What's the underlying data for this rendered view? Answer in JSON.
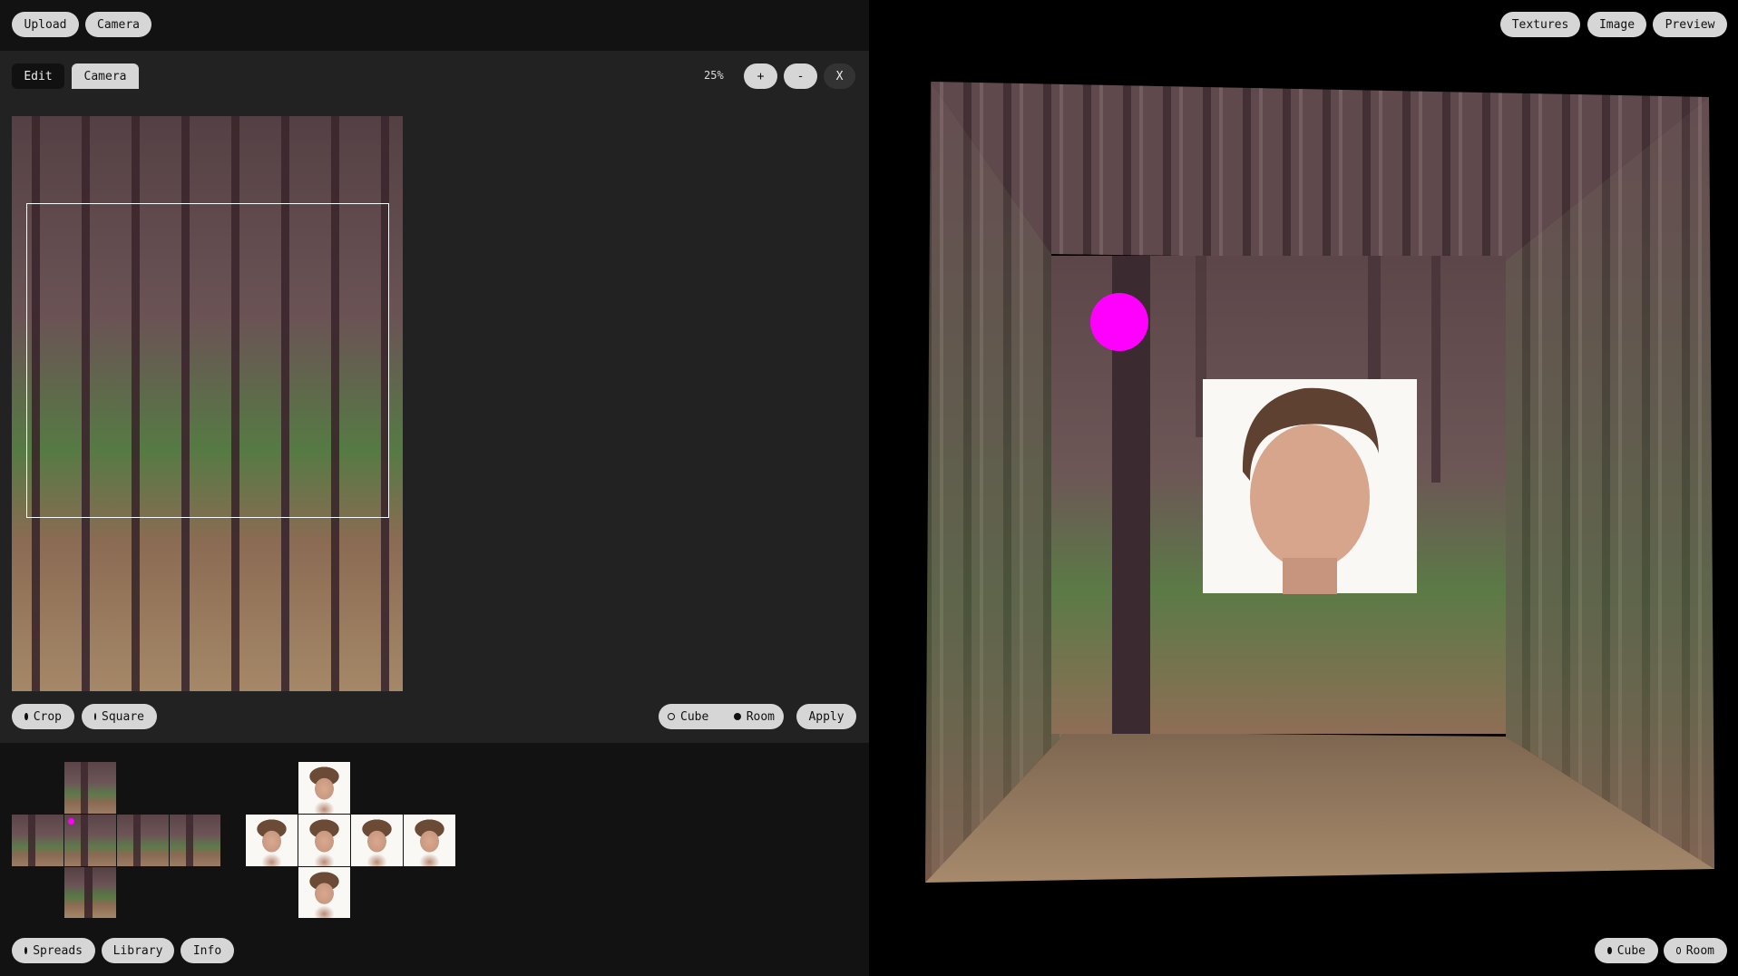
{
  "topbar": {
    "upload_label": "Upload",
    "camera_label": "Camera"
  },
  "editor": {
    "tabs": [
      {
        "label": "Edit",
        "active": true
      },
      {
        "label": "Camera",
        "active": false
      }
    ],
    "zoom": "25%",
    "zoom_in_label": "+",
    "zoom_out_label": "-",
    "close_label": "X",
    "crop_label": "Crop",
    "square_label": "Square",
    "cube_label": "Cube",
    "room_label": "Room",
    "apply_label": "Apply"
  },
  "bottom": {
    "spreads_label": "Spreads",
    "library_label": "Library",
    "info_label": "Info"
  },
  "viewer": {
    "textures_label": "Textures",
    "image_label": "Image",
    "preview_label": "Preview",
    "cube_label": "Cube",
    "room_label": "Room",
    "marker_color": "#ff00ff"
  },
  "icons": [
    "radio-filled-icon",
    "radio-empty-icon"
  ]
}
